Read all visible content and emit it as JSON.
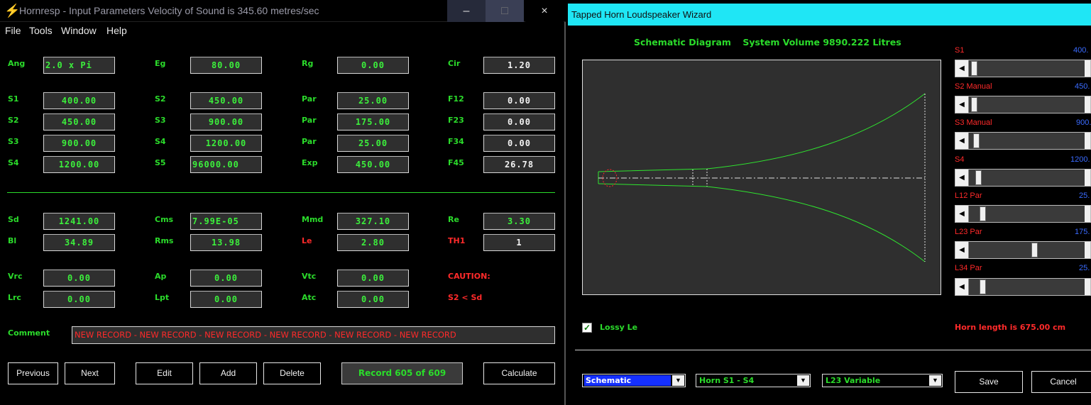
{
  "left_window": {
    "title": "Hornresp - Input Parameters   Velocity of Sound is 345.60 metres/sec",
    "controls": {
      "minimize": "–",
      "maximize": "□",
      "close": "×"
    },
    "menu": [
      "File",
      "Tools",
      "Window",
      "Help"
    ],
    "params": {
      "ang": {
        "label": "Ang",
        "value": "2.0 x Pi"
      },
      "eg": {
        "label": "Eg",
        "value": "80.00"
      },
      "rg": {
        "label": "Rg",
        "value": "0.00"
      },
      "cir": {
        "label": "Cir",
        "value": "1.20"
      },
      "s1": {
        "label": "S1",
        "value": "400.00"
      },
      "s2b": {
        "label": "S2",
        "value": "450.00"
      },
      "par1": {
        "label": "Par",
        "value": "25.00"
      },
      "f12": {
        "label": "F12",
        "value": "0.00"
      },
      "s2": {
        "label": "S2",
        "value": "450.00"
      },
      "s3b": {
        "label": "S3",
        "value": "900.00"
      },
      "par2": {
        "label": "Par",
        "value": "175.00"
      },
      "f23": {
        "label": "F23",
        "value": "0.00"
      },
      "s3": {
        "label": "S3",
        "value": "900.00"
      },
      "s4b": {
        "label": "S4",
        "value": "1200.00"
      },
      "par3": {
        "label": "Par",
        "value": "25.00"
      },
      "f34": {
        "label": "F34",
        "value": "0.00"
      },
      "s4": {
        "label": "S4",
        "value": "1200.00"
      },
      "s5": {
        "label": "S5",
        "value": "96000.00"
      },
      "exp": {
        "label": "Exp",
        "value": "450.00"
      },
      "f45": {
        "label": "F45",
        "value": "26.78"
      },
      "sd": {
        "label": "Sd",
        "value": "1241.00"
      },
      "cms": {
        "label": "Cms",
        "value": "7.99E-05"
      },
      "mmd": {
        "label": "Mmd",
        "value": "327.10"
      },
      "re": {
        "label": "Re",
        "value": "3.30"
      },
      "bl": {
        "label": "Bl",
        "value": "34.89"
      },
      "rms": {
        "label": "Rms",
        "value": "13.98"
      },
      "le": {
        "label": "Le",
        "value": "2.80"
      },
      "th1": {
        "label": "TH1",
        "value": "1"
      },
      "vrc": {
        "label": "Vrc",
        "value": "0.00"
      },
      "ap": {
        "label": "Ap",
        "value": "0.00"
      },
      "vtc": {
        "label": "Vtc",
        "value": "0.00"
      },
      "lrc": {
        "label": "Lrc",
        "value": "0.00"
      },
      "lpt": {
        "label": "Lpt",
        "value": "0.00"
      },
      "atc": {
        "label": "Atc",
        "value": "0.00"
      }
    },
    "caution": "CAUTION:",
    "caution_detail": "S2 < Sd",
    "comment_label": "Comment",
    "comment_value": "NEW RECORD - NEW RECORD - NEW RECORD - NEW RECORD - NEW RECORD - NEW RECORD",
    "buttons": {
      "previous": "Previous",
      "next": "Next",
      "edit": "Edit",
      "add": "Add",
      "delete": "Delete",
      "calculate": "Calculate"
    },
    "record": "Record 605 of 609"
  },
  "right_window": {
    "title": "Tapped Horn Loudspeaker Wizard",
    "diagram_label": "Schematic Diagram",
    "system_volume": "System Volume 9890.222 Litres",
    "sliders": [
      {
        "label": "S1",
        "value": "400.",
        "position": 0.02
      },
      {
        "label": "S2  Manual",
        "value": "450.",
        "position": 0.02
      },
      {
        "label": "S3  Manual",
        "value": "900.",
        "position": 0.04
      },
      {
        "label": "S4",
        "value": "1200.",
        "position": 0.06
      },
      {
        "label": "L12  Par",
        "value": "25.",
        "position": 0.1
      },
      {
        "label": "L23  Par",
        "value": "175.",
        "position": 0.57
      },
      {
        "label": "L34  Par",
        "value": "25.",
        "position": 0.1
      }
    ],
    "lossy_le": "Lossy Le",
    "horn_length": "Horn length is 675.00 cm",
    "combos": {
      "view": "Schematic",
      "section": "Horn S1 - S4",
      "variable": "L23 Variable"
    },
    "buttons": {
      "save": "Save",
      "cancel": "Cancel"
    },
    "colors": {
      "titlebar": "#1fe6f5",
      "label_green": "#2bdc2b",
      "warn_red": "#ff2a2a",
      "value_blue": "#3a6bff"
    }
  }
}
